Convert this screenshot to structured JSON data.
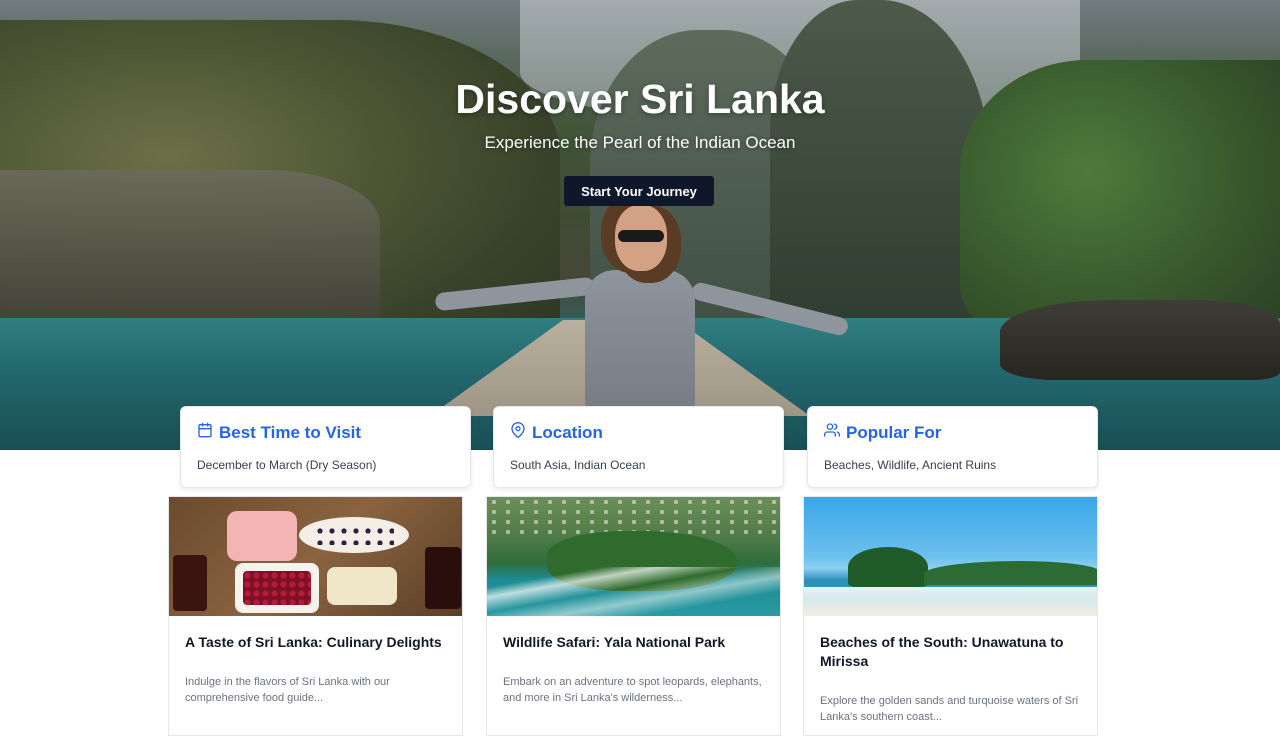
{
  "hero": {
    "title": "Discover Sri Lanka",
    "subtitle": "Experience the Pearl of the Indian Ocean",
    "cta_label": "Start Your Journey"
  },
  "info_cards": [
    {
      "icon": "calendar-icon",
      "title": "Best Time to Visit",
      "text": "December to March (Dry Season)"
    },
    {
      "icon": "map-pin-icon",
      "title": "Location",
      "text": "South Asia, Indian Ocean"
    },
    {
      "icon": "users-icon",
      "title": "Popular For",
      "text": "Beaches, Wildlife, Ancient Ruins"
    }
  ],
  "articles": [
    {
      "title": "A Taste of Sri Lanka: Culinary Delights",
      "excerpt": "Indulge in the flavors of Sri Lanka with our comprehensive food guide..."
    },
    {
      "title": "Wildlife Safari: Yala National Park",
      "excerpt": "Embark on an adventure to spot leopards, elephants, and more in Sri Lanka's wilderness..."
    },
    {
      "title": "Beaches of the South: Unawatuna to Mirissa",
      "excerpt": "Explore the golden sands and turquoise waters of Sri Lanka's southern coast..."
    }
  ],
  "colors": {
    "accent": "#2563eb",
    "cta_background": "#0f172a"
  }
}
